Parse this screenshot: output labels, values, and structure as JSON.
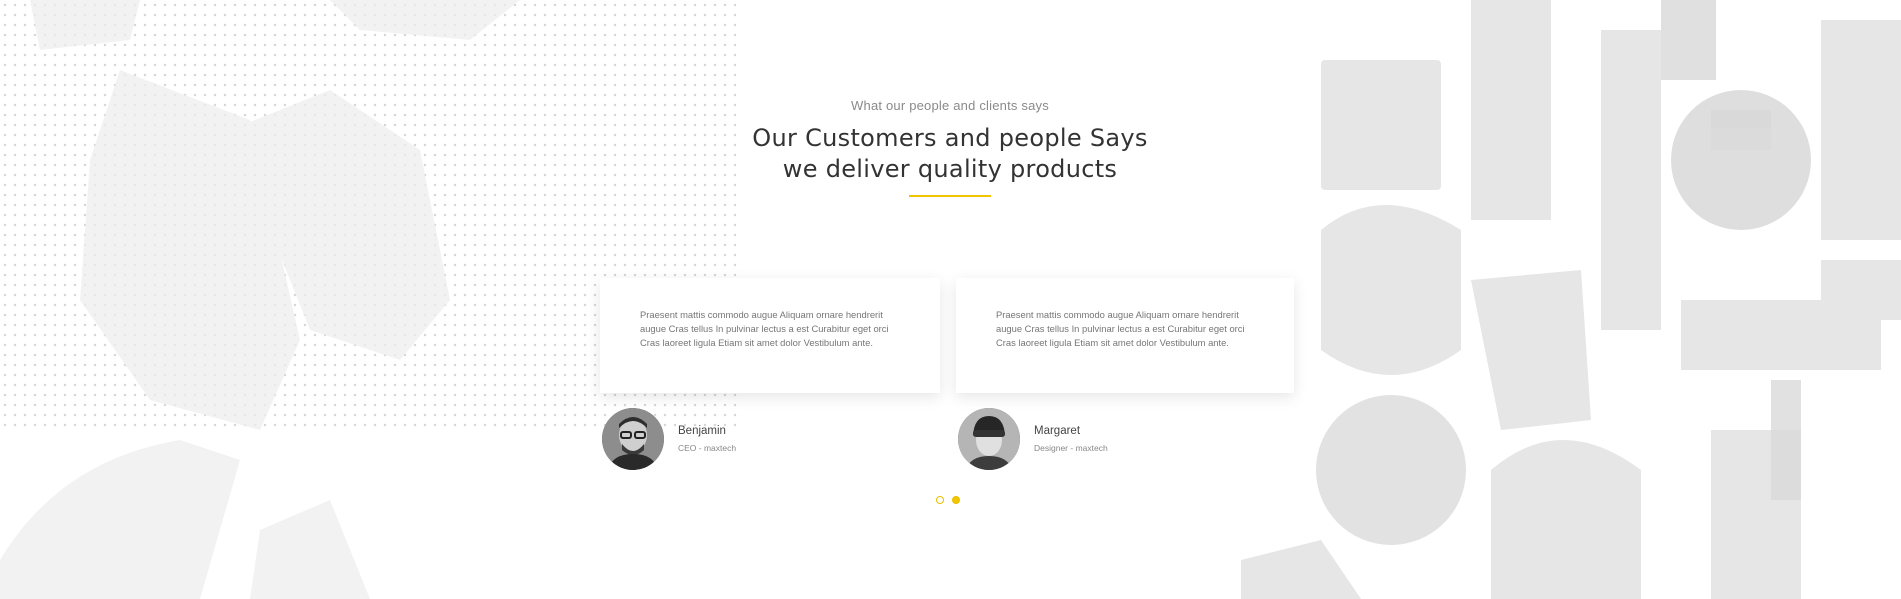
{
  "section": {
    "eyebrow": "What our people and clients says",
    "title_line1": "Our Customers and people Says",
    "title_line2": "we deliver quality products",
    "accent_color": "#f2c500"
  },
  "testimonials": [
    {
      "quote": "Praesent mattis commodo augue Aliquam ornare hendrerit augue Cras tellus In pulvinar lectus a est Curabitur eget orci Cras laoreet ligula Etiam sit amet dolor Vestibulum ante.",
      "name": "Benjamin",
      "role": "CEO - maxtech",
      "avatar_icon": "man-with-glasses-avatar"
    },
    {
      "quote": "Praesent mattis commodo augue Aliquam ornare hendrerit augue Cras tellus In pulvinar lectus a est Curabitur eget orci Cras laoreet ligula Etiam sit amet dolor Vestibulum ante.",
      "name": "Margaret",
      "role": "Designer - maxtech",
      "avatar_icon": "person-with-beanie-avatar"
    }
  ],
  "carousel": {
    "pages": 2,
    "active_page": 2
  }
}
